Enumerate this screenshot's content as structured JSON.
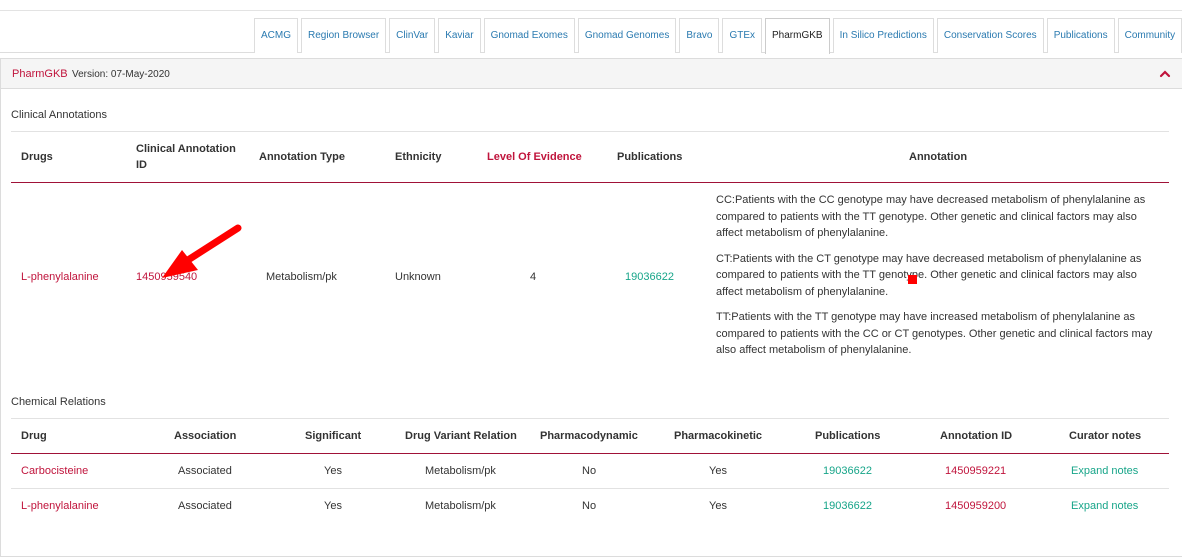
{
  "tabs": [
    {
      "label": "ACMG",
      "active": false
    },
    {
      "label": "Region Browser",
      "active": false
    },
    {
      "label": "ClinVar",
      "active": false
    },
    {
      "label": "Kaviar",
      "active": false
    },
    {
      "label": "Gnomad Exomes",
      "active": false
    },
    {
      "label": "Gnomad Genomes",
      "active": false
    },
    {
      "label": "Bravo",
      "active": false
    },
    {
      "label": "GTEx",
      "active": false
    },
    {
      "label": "PharmGKB",
      "active": true
    },
    {
      "label": "In Silico Predictions",
      "active": false
    },
    {
      "label": "Conservation Scores",
      "active": false
    },
    {
      "label": "Publications",
      "active": false
    },
    {
      "label": "Community",
      "active": false
    }
  ],
  "panel": {
    "title": "PharmGKB",
    "version": "Version: 07-May-2020",
    "collapse_icon": "chevron-up-icon"
  },
  "clinical": {
    "title": "Clinical Annotations",
    "headers": {
      "drugs": "Drugs",
      "id_line1": "Clinical Annotation",
      "id_line2": "ID",
      "type": "Annotation Type",
      "ethnicity": "Ethnicity",
      "level": "Level Of Evidence",
      "publications": "Publications",
      "annotation": "Annotation"
    },
    "row": {
      "drug": "L-phenylalanine",
      "id": "1450959540",
      "type": "Metabolism/pk",
      "ethnicity": "Unknown",
      "level": "4",
      "publication": "19036622",
      "annotations": [
        "CC:Patients with the CC genotype may have decreased metabolism of phenylalanine as compared to patients with the TT genotype. Other genetic and clinical factors may also affect metabolism of phenylalanine.",
        "CT:Patients with the CT genotype may have decreased metabolism of phenylalanine as compared to patients with the TT genotype. Other genetic and clinical factors may also affect metabolism of phenylalanine.",
        "TT:Patients with the TT genotype may have increased metabolism of phenylalanine as compared to patients with the CC or CT genotypes. Other genetic and clinical factors may also affect metabolism of phenylalanine."
      ]
    }
  },
  "chemical": {
    "title": "Chemical Relations",
    "headers": {
      "drug": "Drug",
      "association": "Association",
      "significant": "Significant",
      "relation": "Drug Variant Relation",
      "pd": "Pharmacodynamic",
      "pk": "Pharmacokinetic",
      "publications": "Publications",
      "annotation_id": "Annotation ID",
      "notes": "Curator notes"
    },
    "rows": [
      {
        "drug": "Carbocisteine",
        "association": "Associated",
        "significant": "Yes",
        "relation": "Metabolism/pk",
        "pd": "No",
        "pk": "Yes",
        "publication": "19036622",
        "annotation_id": "1450959221",
        "notes": "Expand notes"
      },
      {
        "drug": "L-phenylalanine",
        "association": "Associated",
        "significant": "Yes",
        "relation": "Metabolism/pk",
        "pd": "No",
        "pk": "Yes",
        "publication": "19036622",
        "annotation_id": "1450959200",
        "notes": "Expand notes"
      }
    ]
  },
  "colors": {
    "accent_red": "#c0143c",
    "link_green": "#17a589",
    "tab_blue": "#2a7ab0",
    "arrow_red": "#ff0000"
  },
  "overlay": {
    "arrow_icon": "red-arrow-icon",
    "marker_icon": "red-square-marker"
  }
}
